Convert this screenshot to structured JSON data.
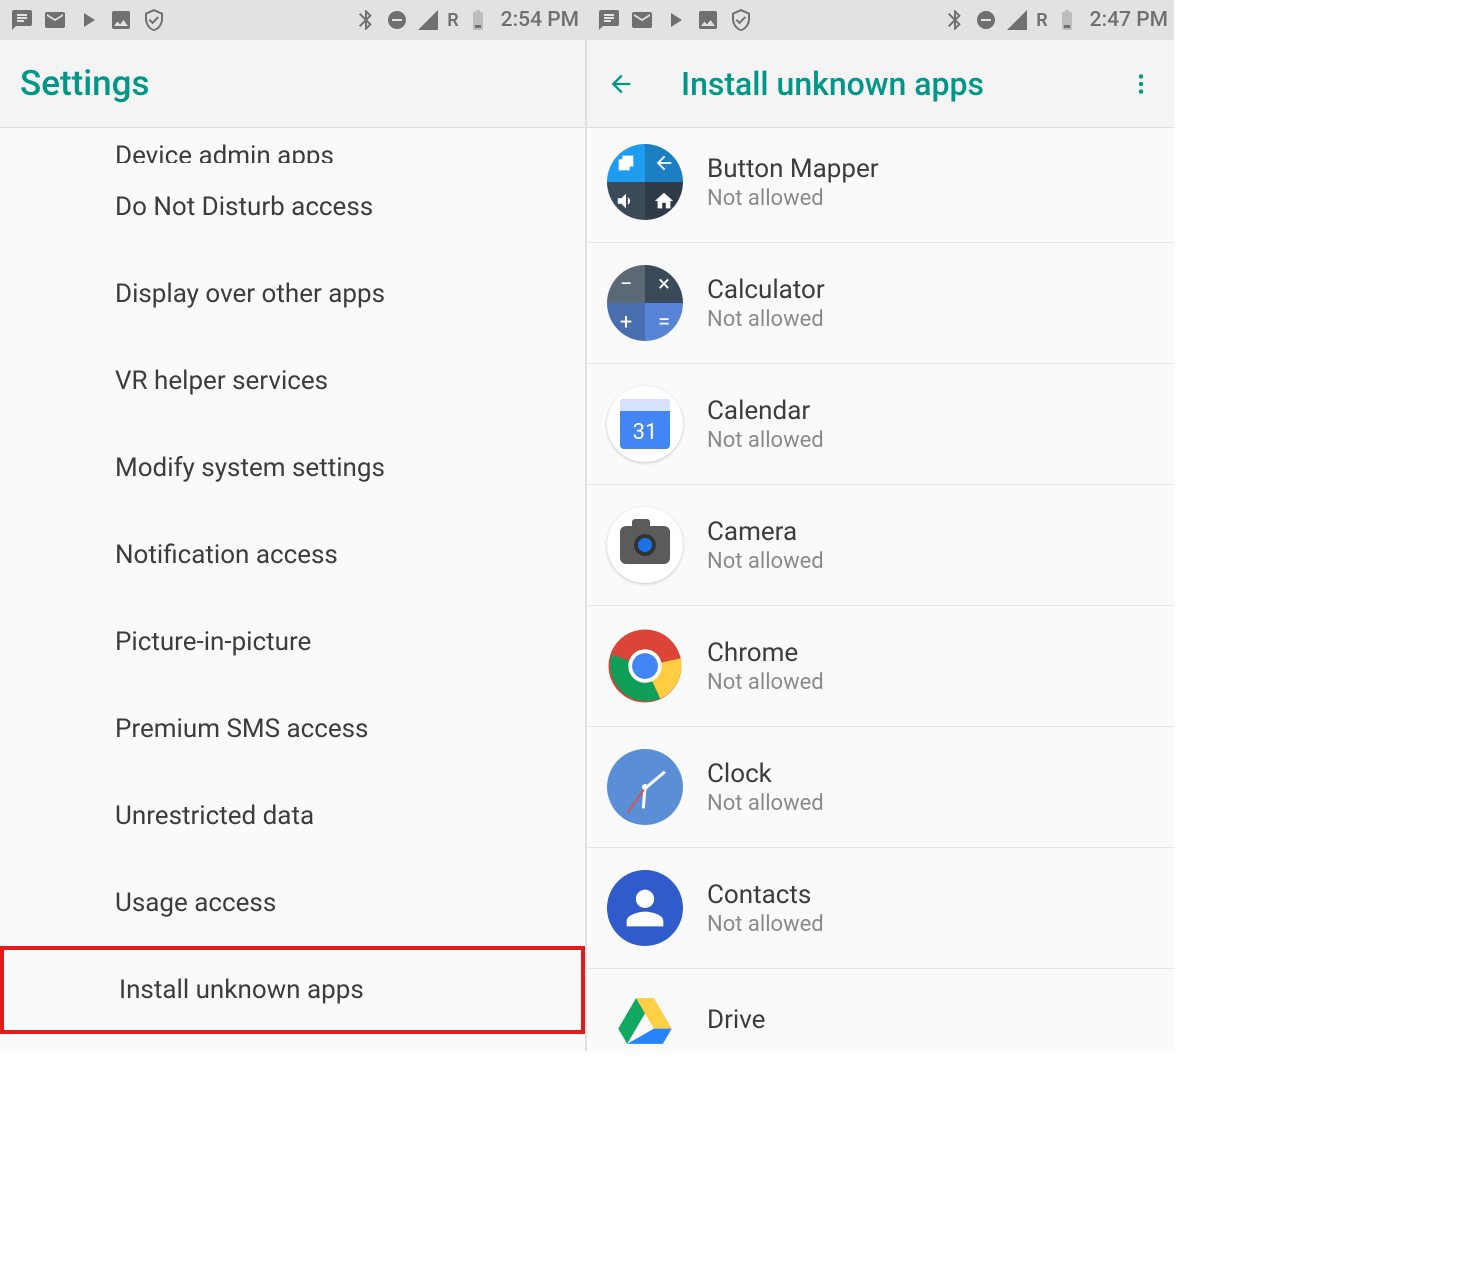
{
  "left": {
    "status": {
      "time": "2:54 PM",
      "roaming": "R"
    },
    "appbar": {
      "title": "Settings"
    },
    "cut_item": "Device admin apps",
    "items": [
      "Do Not Disturb access",
      "Display over other apps",
      "VR helper services",
      "Modify system settings",
      "Notification access",
      "Picture-in-picture",
      "Premium SMS access",
      "Unrestricted data",
      "Usage access",
      "Install unknown apps"
    ]
  },
  "right": {
    "status": {
      "time": "2:47 PM",
      "roaming": "R"
    },
    "appbar": {
      "title": "Install unknown apps"
    },
    "calendar_day": "31",
    "apps": [
      {
        "name": "Button Mapper",
        "status": "Not allowed"
      },
      {
        "name": "Calculator",
        "status": "Not allowed"
      },
      {
        "name": "Calendar",
        "status": "Not allowed"
      },
      {
        "name": "Camera",
        "status": "Not allowed"
      },
      {
        "name": "Chrome",
        "status": "Not allowed"
      },
      {
        "name": "Clock",
        "status": "Not allowed"
      },
      {
        "name": "Contacts",
        "status": "Not allowed"
      },
      {
        "name": "Drive",
        "status": ""
      }
    ]
  }
}
